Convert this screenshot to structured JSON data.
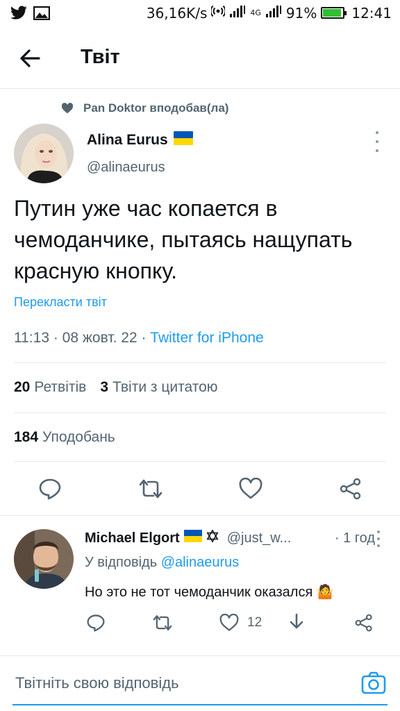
{
  "status_bar": {
    "speed": "36,16K/s",
    "network": "4G",
    "battery_percent": "91%",
    "battery_level": 0.91,
    "time": "12:41"
  },
  "header": {
    "title": "Твіт"
  },
  "liked_by": "Pan Doktor вподобав(ла)",
  "tweet": {
    "author_name": "Alina Eurus",
    "author_handle": "@alinaeurus",
    "text": "Путин уже час копается в чемоданчике, пытаясь нащупать красную кнопку.",
    "translate_label": "Перекласти твіт",
    "time": "11:13",
    "date": "08 жовт. 22",
    "source": "Twitter for iPhone",
    "retweets_count": "20",
    "retweets_label": "Ретвітів",
    "quotes_count": "3",
    "quotes_label": "Твіти з цитатою",
    "likes_count": "184",
    "likes_label": "Уподобань"
  },
  "reply": {
    "author_name": "Michael Elgort",
    "author_handle": "@just_w...",
    "time": "· 1 год",
    "replying_prefix": "У відповідь",
    "replying_to": "@alinaeurus",
    "text": "Но это не тот чемоданчик оказался 🤷",
    "like_count": "12"
  },
  "compose": {
    "placeholder": "Твітніть свою відповідь"
  },
  "colors": {
    "accent": "#1d9bf0",
    "text": "#0f1419",
    "secondary": "#536471",
    "flag_blue": "#0057b7",
    "flag_yellow": "#ffd700"
  }
}
